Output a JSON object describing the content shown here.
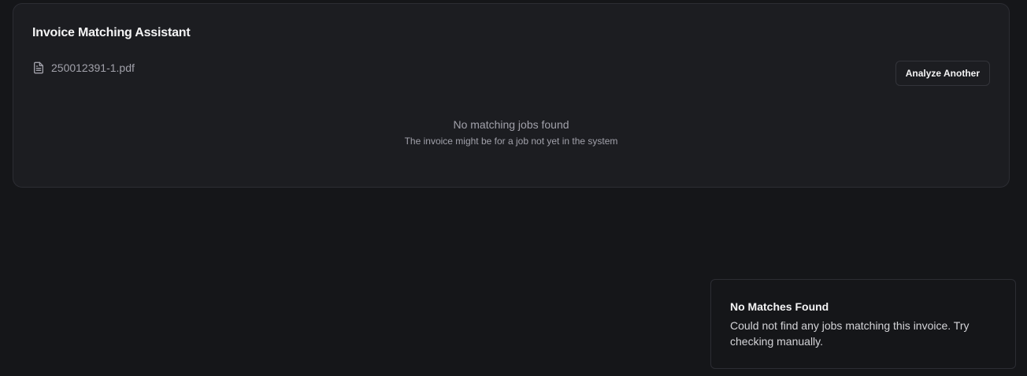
{
  "card": {
    "title": "Invoice Matching Assistant",
    "file_icon": "file-text-icon",
    "file_name": "250012391-1.pdf",
    "analyze_button_label": "Analyze Another",
    "empty_title": "No matching jobs found",
    "empty_subtitle": "The invoice might be for a job not yet in the system"
  },
  "toast": {
    "title": "No Matches Found",
    "description": "Could not find any jobs matching this invoice. Try checking manually."
  },
  "colors": {
    "page_background": "#151619",
    "card_background": "#1c1d21",
    "border": "#2c2d33",
    "text_primary": "#f4f4f5",
    "text_muted": "#a1a1aa"
  }
}
